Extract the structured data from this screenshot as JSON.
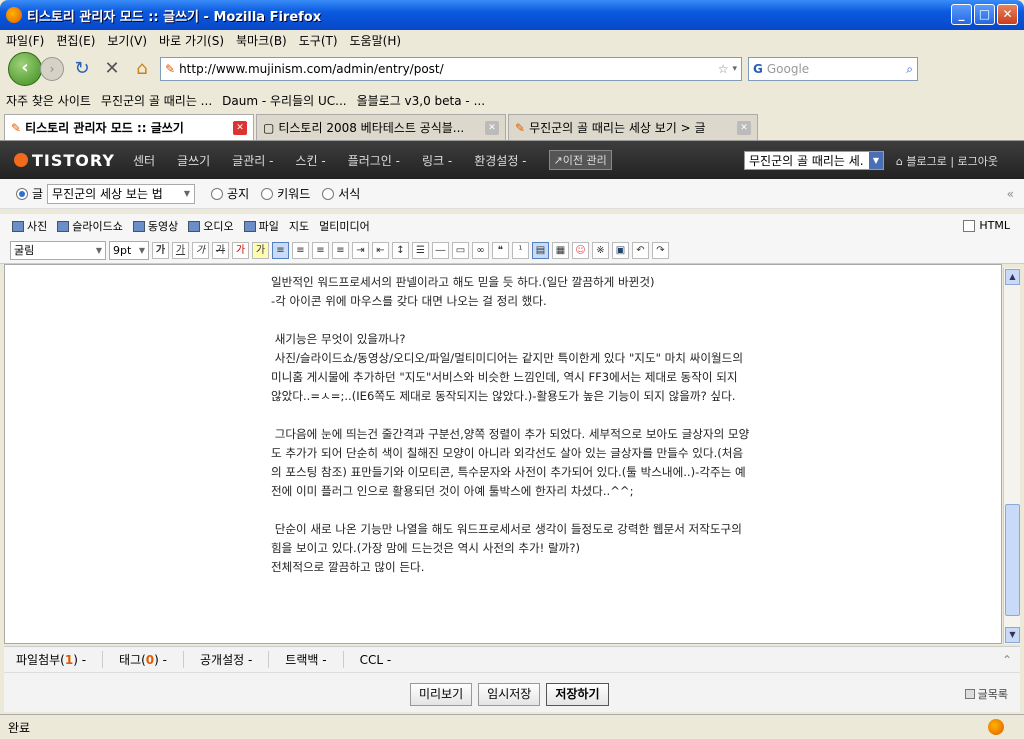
{
  "window": {
    "title": "티스토리 관리자 모드 :: 글쓰기 - Mozilla Firefox"
  },
  "menu": [
    "파일(F)",
    "편집(E)",
    "보기(V)",
    "바로 가기(S)",
    "북마크(B)",
    "도구(T)",
    "도움말(H)"
  ],
  "nav": {
    "url": "http://www.mujinism.com/admin/entry/post/",
    "search_placeholder": "Google"
  },
  "bookmarks": [
    "자주 찾은 사이트",
    "무진군의 골 때리는 ...",
    "Daum - 우리들의 UC...",
    "올블로그 v3,0 beta - ..."
  ],
  "tabs": [
    {
      "label": "티스토리 관리자 모드 :: 글쓰기"
    },
    {
      "label": "티스토리 2008 베타테스트 공식블..."
    },
    {
      "label": "무진군의 골 때리는 세상 보기 > 글"
    }
  ],
  "tistory": {
    "logo": "TISTORY",
    "nav": [
      "센터",
      "글쓰기",
      "글관리 -",
      "스킨 -",
      "플러그인 -",
      "링크 -",
      "환경설정 -"
    ],
    "prev_admin": "↗이전 관리",
    "blog_select": "무진군의 골 때리는 세.",
    "links": "⌂ 블로그로 | 로그아웃"
  },
  "category_row": {
    "type_post": "글",
    "category": "무진군의 세상 보는 법",
    "type_notice": "공지",
    "type_keyword": "키워드",
    "type_form": "서식"
  },
  "media": [
    "사진",
    "슬라이드쇼",
    "동영상",
    "오디오",
    "파일",
    "지도",
    "멀티미디어"
  ],
  "html_toggle": "HTML",
  "format": {
    "font": "굴림",
    "size": "9pt"
  },
  "content": {
    "text": "일반적인 워드프로세서의 판넬이라고 해도 믿을 듯 하다.(일단 깔끔하게 바뀐것)\n-각 아이콘 위에 마우스를 갖다 대면 나오는 걸 정리 했다.\n\n 새기능은 무엇이 있을까나?\n 사진/슬라이드쇼/동영상/오디오/파일/멀티미디어는 같지만 특이한게 있다 \"지도\" 마치 싸이월드의 미니홈 게시물에 추가하던 \"지도\"서비스와 비슷한 느낌인데, 역시 FF3에서는 제대로 동작이 되지 않았다..=ㅅ=;..(IE6쪽도 제대로 동작되지는 않았다.)-활용도가 높은 기능이 되지 않을까? 싶다.\n\n 그다음에 눈에 띄는건 줄간격과 구분선,양쪽 정렬이 추가 되었다. 세부적으로 보아도 글상자의 모양도 추가가 되어 단순히 색이 칠해진 모양이 아니라 외각선도 살아 있는 글상자를 만들수 있다.(처음의 포스팅 참조) 표만들기와 이모티콘, 특수문자와 사전이 추가되어 있다.(툴 박스내에..)-각주는 예전에 이미 플러그 인으로 활용되던 것이 아예 툴박스에 한자리 차셨다..^^;\n\n 단순이 새로 나온 기능만 나열을 해도 워드프로세서로 생각이 들정도로 강력한 웹문서 저작도구의 힘을 보이고 있다.(가장 맘에 드는것은 역시 사전의 추가! 랄까?)\n전체적으로 깔끔하고 많이 든다."
  },
  "options": [
    {
      "label": "파일첨부(",
      "count": "1",
      "end": ") -"
    },
    {
      "label": "태그(",
      "count": "0",
      "end": ") -"
    },
    {
      "label": "공개설정 -"
    },
    {
      "label": "트랙백 -"
    },
    {
      "label": "CCL -"
    }
  ],
  "actions": {
    "preview": "미리보기",
    "draft": "임시저장",
    "save": "저장하기",
    "post_list": "글목록"
  },
  "status": "완료"
}
